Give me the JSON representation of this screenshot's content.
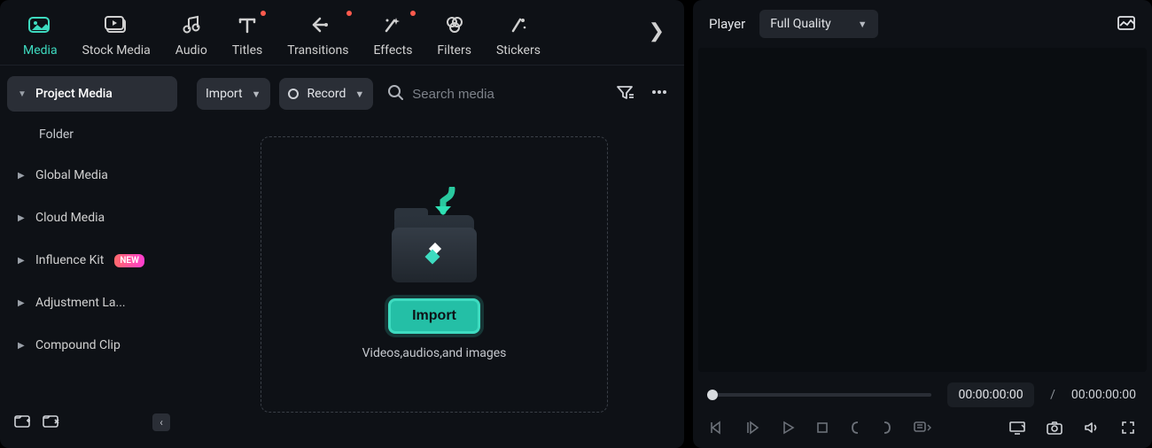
{
  "topnav": {
    "items": [
      {
        "label": "Media",
        "active": true
      },
      {
        "label": "Stock Media"
      },
      {
        "label": "Audio"
      },
      {
        "label": "Titles",
        "dot": true
      },
      {
        "label": "Transitions",
        "dot": true
      },
      {
        "label": "Effects",
        "dot": true
      },
      {
        "label": "Filters"
      },
      {
        "label": "Stickers"
      }
    ],
    "more_glyph": "❯"
  },
  "sidebar": {
    "items": [
      {
        "label": "Project Media",
        "active": true,
        "expanded": true
      },
      {
        "label": "Folder",
        "plain": true
      },
      {
        "label": "Global Media"
      },
      {
        "label": "Cloud Media"
      },
      {
        "label": "Influence Kit",
        "badge": "NEW"
      },
      {
        "label": "Adjustment La..."
      },
      {
        "label": "Compound Clip"
      }
    ]
  },
  "toolbar": {
    "import_label": "Import",
    "record_label": "Record",
    "search_placeholder": "Search media"
  },
  "dropzone": {
    "button_label": "Import",
    "hint": "Videos,audios,and images"
  },
  "player": {
    "title": "Player",
    "quality": "Full Quality",
    "time_current": "00:00:00:00",
    "time_sep": "/",
    "time_total": "00:00:00:00"
  }
}
